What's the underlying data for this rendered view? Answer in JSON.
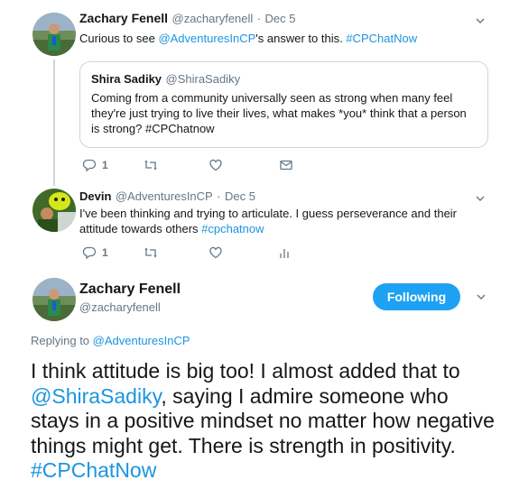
{
  "tweet1": {
    "name": "Zachary Fenell",
    "handle": "@zacharyfenell",
    "sep": "·",
    "date": "Dec 5",
    "text_before": "Curious to see ",
    "mention": "@AdventuresInCP",
    "text_after": "'s answer to this. ",
    "hashtag": "#CPChatNow",
    "quote": {
      "name": "Shira Sadiky",
      "handle": "@ShiraSadiky",
      "text": "Coming from a community universally seen as strong when many feel they're just trying to live their lives, what makes *you* think that a person is strong? #CPChatnow"
    },
    "reply_count": "1"
  },
  "tweet2": {
    "name": "Devin",
    "handle": "@AdventuresInCP",
    "sep": "·",
    "date": "Dec 5",
    "text": "I've been thinking and trying to articulate. I guess perseverance and their attitude towards others ",
    "hashtag": "#cpchatnow",
    "reply_count": "1"
  },
  "main": {
    "name": "Zachary Fenell",
    "handle": "@zacharyfenell",
    "follow_label": "Following",
    "replying_prefix": "Replying to ",
    "replying_to": "@AdventuresInCP",
    "text_1": "I think attitude is big too! I almost added that to ",
    "mention": "@ShiraSadiky",
    "text_2": ", saying I admire someone who stays in a positive mindset no matter how negative things might get. There is strength in positivity. ",
    "hashtag": "#CPChatNow"
  },
  "colors": {
    "accent": "#1da1f2",
    "link": "#1b95e0",
    "muted": "#657786",
    "border": "#ccd6dd"
  }
}
